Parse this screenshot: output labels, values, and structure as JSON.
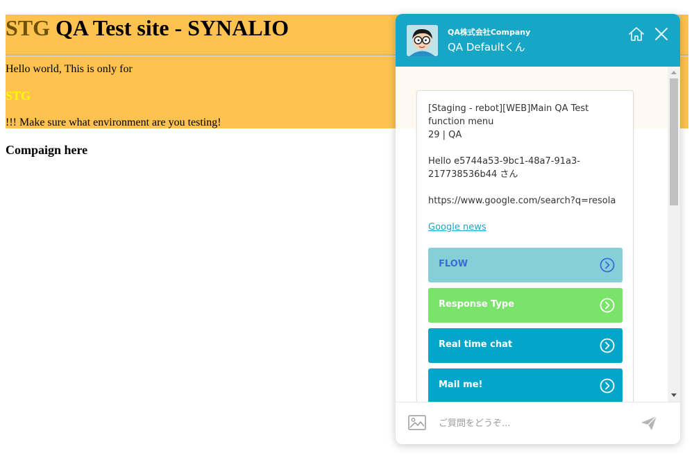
{
  "page": {
    "title_env": "STG",
    "title_rest": " QA Test site - SYNALIO",
    "hello": "Hello world, This is only for",
    "stg_label": "STG",
    "warning": "!!! Make sure what environment are you testing!",
    "campaign": "Compaign here"
  },
  "colors": {
    "banner": "#fdc24f",
    "chat_header": "#17a6c6",
    "flow_button": "#85d0d8",
    "response_button": "#7ae36a",
    "realtime_button": "#03a5c9",
    "mail_button": "#03a5c9"
  },
  "chat": {
    "company": "QA株式会社Company",
    "bot_name": "QA Defaultくん",
    "message": "[Staging - rebot][WEB]Main QA Test function menu\n29 | QA\n\nHello e5744a53-9bc1-48a7-91a3-217738536b44 さん\n\nhttps://www.google.com/search?q=resola",
    "link": "Google news",
    "buttons": [
      {
        "label": "FLOW"
      },
      {
        "label": "Response Type"
      },
      {
        "label": "Real time chat"
      },
      {
        "label": "Mail me!"
      }
    ],
    "input_placeholder": "ご質問をどうぞ..."
  }
}
